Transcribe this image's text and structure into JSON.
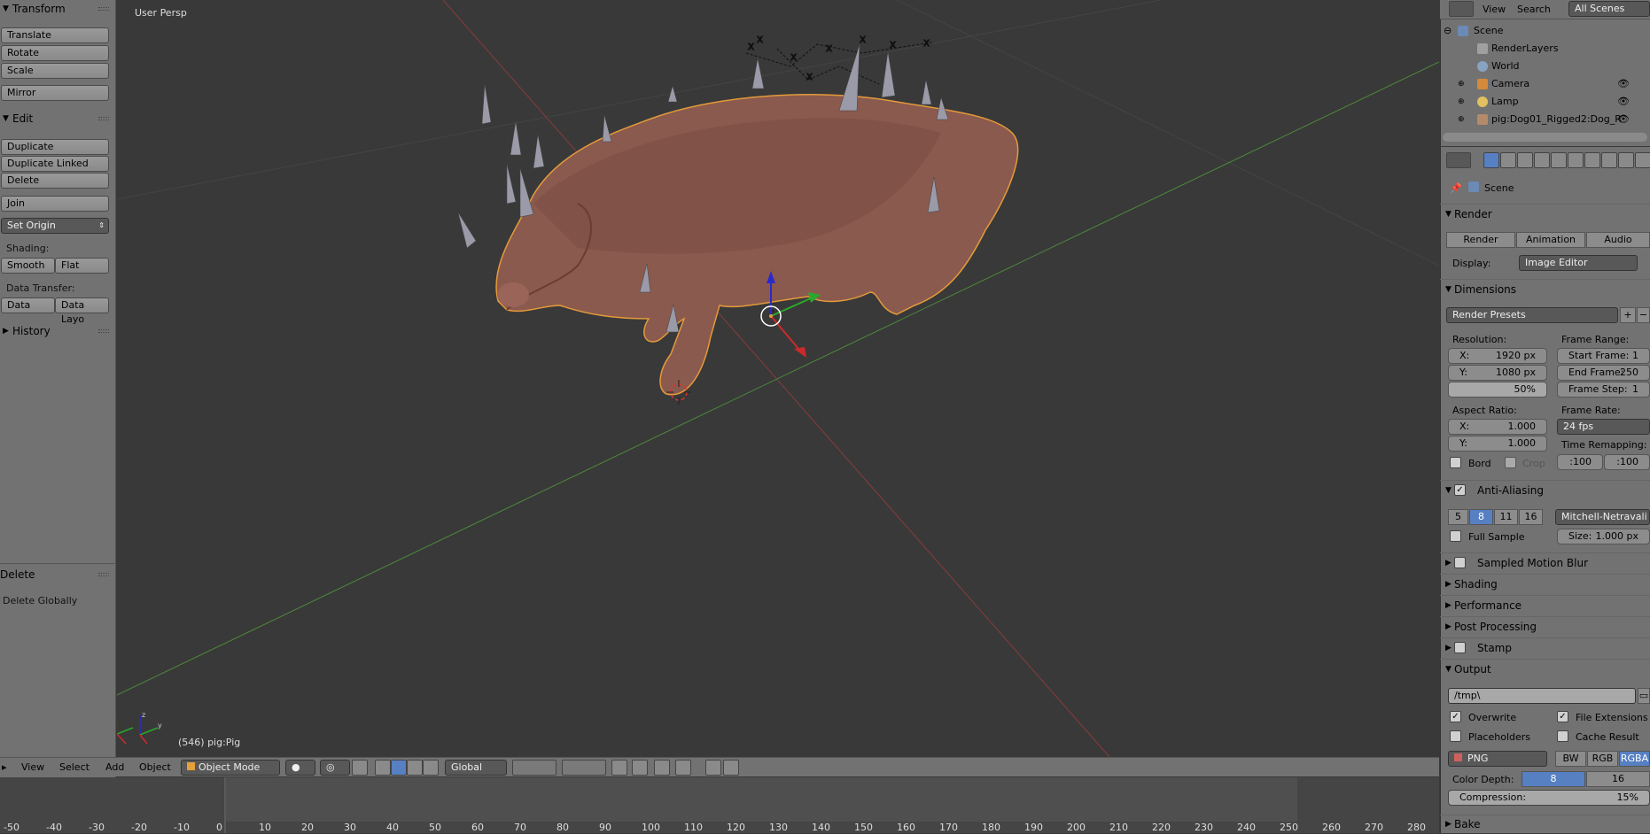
{
  "toolshelf": {
    "transform_header": "Transform",
    "translate": "Translate",
    "rotate": "Rotate",
    "scale": "Scale",
    "mirror": "Mirror",
    "edit_header": "Edit",
    "duplicate": "Duplicate",
    "duplicate_linked": "Duplicate Linked",
    "delete": "Delete",
    "join": "Join",
    "set_origin": "Set Origin",
    "shading_label": "Shading:",
    "smooth": "Smooth",
    "flat": "Flat",
    "data_transfer_label": "Data Transfer:",
    "data": "Data",
    "data_layout": "Data Layo",
    "history_header": "History",
    "operator_header": "Delete",
    "delete_globally": "Delete Globally"
  },
  "viewport": {
    "title": "User Persp",
    "info": "(546) pig:Pig"
  },
  "header": {
    "view": "View",
    "select": "Select",
    "add": "Add",
    "object": "Object",
    "mode": "Object Mode",
    "orientation": "Global"
  },
  "timeline": {
    "ticks": [
      "-50",
      "-40",
      "-30",
      "-20",
      "-10",
      "0",
      "10",
      "20",
      "30",
      "40",
      "50",
      "60",
      "70",
      "80",
      "90",
      "100",
      "110",
      "120",
      "130",
      "140",
      "150",
      "160",
      "170",
      "180",
      "190",
      "200",
      "210",
      "220",
      "230",
      "240",
      "250",
      "260",
      "270",
      "280"
    ]
  },
  "outliner": {
    "view": "View",
    "search": "Search",
    "scenes": "All Scenes",
    "items": [
      "Scene",
      "RenderLayers",
      "World",
      "Camera",
      "Lamp",
      "pig:Dog01_Rigged2:Dog_R"
    ]
  },
  "properties": {
    "context": "Scene",
    "render_header": "Render",
    "render_btn": "Render",
    "animation_btn": "Animation",
    "audio_btn": "Audio",
    "display_label": "Display:",
    "display_value": "Image Editor",
    "dimensions_header": "Dimensions",
    "render_presets": "Render Presets",
    "resolution_label": "Resolution:",
    "res_x_label": "X:",
    "res_x": "1920 px",
    "res_y_label": "Y:",
    "res_y": "1080 px",
    "res_pct": "50%",
    "frame_range_label": "Frame Range:",
    "start_frame_label": "Start Frame:",
    "start_frame": "1",
    "end_frame_label": "End Frame:",
    "end_frame": "250",
    "frame_step_label": "Frame Step:",
    "frame_step": "1",
    "aspect_label": "Aspect Ratio:",
    "asp_x_label": "X:",
    "asp_x": "1.000",
    "asp_y_label": "Y:",
    "asp_y": "1.000",
    "frame_rate_label": "Frame Rate:",
    "frame_rate": "24 fps",
    "time_remap_label": "Time Remapping:",
    "remap_old": ":100",
    "remap_new": ":100",
    "border": "Bord",
    "crop": "Crop",
    "aa_header": "Anti-Aliasing",
    "aa_5": "5",
    "aa_8": "8",
    "aa_11": "11",
    "aa_16": "16",
    "aa_filter": "Mitchell-Netravali",
    "full_sample": "Full Sample",
    "size_label": "Size:",
    "size_value": "1.000 px",
    "motion_blur": "Sampled Motion Blur",
    "shading": "Shading",
    "performance": "Performance",
    "post_processing": "Post Processing",
    "stamp": "Stamp",
    "output_header": "Output",
    "output_path": "/tmp\\",
    "overwrite": "Overwrite",
    "file_extensions": "File Extensions",
    "placeholders": "Placeholders",
    "cache_result": "Cache Result",
    "format": "PNG",
    "bw": "BW",
    "rgb": "RGB",
    "rgba": "RGBA",
    "color_depth_label": "Color Depth:",
    "depth_8": "8",
    "depth_16": "16",
    "compression_label": "Compression:",
    "compression": "15%",
    "bake": "Bake"
  }
}
